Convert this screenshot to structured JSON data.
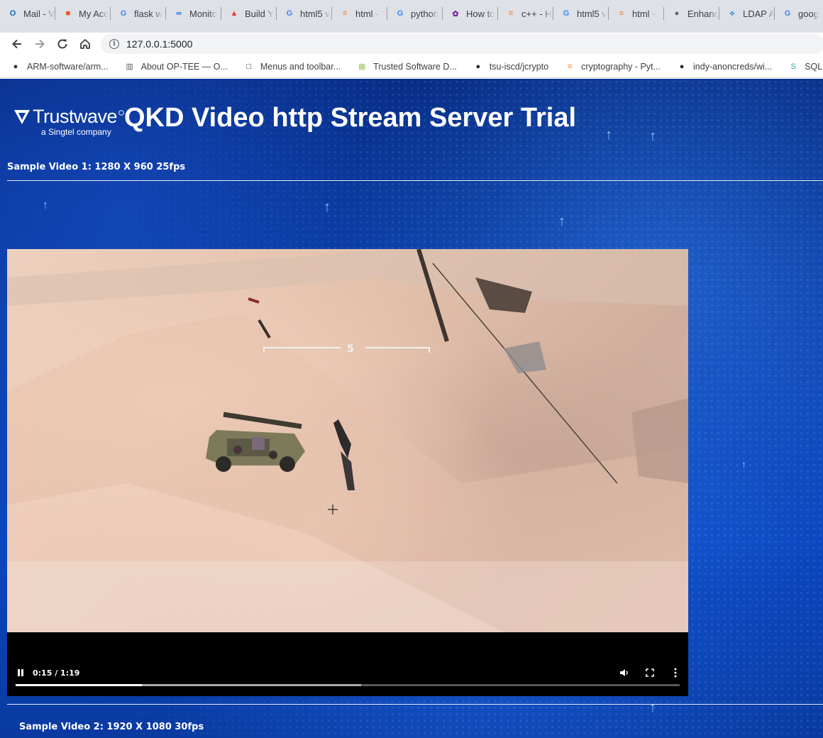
{
  "browser": {
    "tabs": [
      {
        "title": "Mail - V",
        "icon": "outlook-icon",
        "color": "#0f6cbd"
      },
      {
        "title": "My Acc",
        "icon": "microsoft-icon",
        "color": "#f25022"
      },
      {
        "title": "flask w",
        "icon": "google-icon",
        "color": "#4285f4"
      },
      {
        "title": "Monito",
        "icon": "monitor-icon",
        "color": "#1a73e8"
      },
      {
        "title": "Build Y",
        "icon": "build-icon",
        "color": "#e53935"
      },
      {
        "title": "html5 v",
        "icon": "google-icon",
        "color": "#4285f4"
      },
      {
        "title": "html - ",
        "icon": "stackoverflow-icon",
        "color": "#f48024"
      },
      {
        "title": "python",
        "icon": "google-icon",
        "color": "#4285f4"
      },
      {
        "title": "How to",
        "icon": "howto-icon",
        "color": "#7b1fa2"
      },
      {
        "title": "c++ - H",
        "icon": "stackoverflow-icon",
        "color": "#f48024"
      },
      {
        "title": "html5 v",
        "icon": "google-icon",
        "color": "#4285f4"
      },
      {
        "title": "html - ",
        "icon": "stackoverflow-icon",
        "color": "#f48024"
      },
      {
        "title": "Enhanc",
        "icon": "globe-icon",
        "color": "#5f6368"
      },
      {
        "title": "LDAP A",
        "icon": "ldap-icon",
        "color": "#1e88e5"
      },
      {
        "title": "goog",
        "icon": "google-icon",
        "color": "#4285f4"
      }
    ],
    "url": "127.0.0.1:5000",
    "bookmarks": [
      {
        "label": "ARM-software/arm...",
        "icon": "github-icon",
        "color": "#24292e"
      },
      {
        "label": "About OP-TEE — O...",
        "icon": "book-icon",
        "color": "#5f6368"
      },
      {
        "label": "Menus and toolbar...",
        "icon": "square-icon",
        "color": "#202124"
      },
      {
        "label": "Trusted Software D...",
        "icon": "grid-icon",
        "color": "#9ccc65"
      },
      {
        "label": "tsu-iscd/jcrypto",
        "icon": "github-icon",
        "color": "#24292e"
      },
      {
        "label": "cryptography - Pyt...",
        "icon": "stackoverflow-icon",
        "color": "#f48024"
      },
      {
        "label": "indy-anoncreds/wi...",
        "icon": "github-icon",
        "color": "#24292e"
      },
      {
        "label": "SQLite Python",
        "icon": "sqlite-icon",
        "color": "#26a69a"
      }
    ]
  },
  "page": {
    "brand_name": "Trustwave",
    "brand_tagline": "a Singtel company",
    "title": "QKD Video http Stream Server Trial",
    "video1_label": "Sample Video 1: 1280 X 960 25fps",
    "video2_label": "Sample Video 2: 1920 X 1080 30fps"
  },
  "player": {
    "state": "playing",
    "current_time": "0:15",
    "duration": "1:19",
    "time_display": "0:15 / 1:19",
    "progress_fraction": 0.19,
    "buffered_fraction": 0.52,
    "reticle_label": "5"
  }
}
